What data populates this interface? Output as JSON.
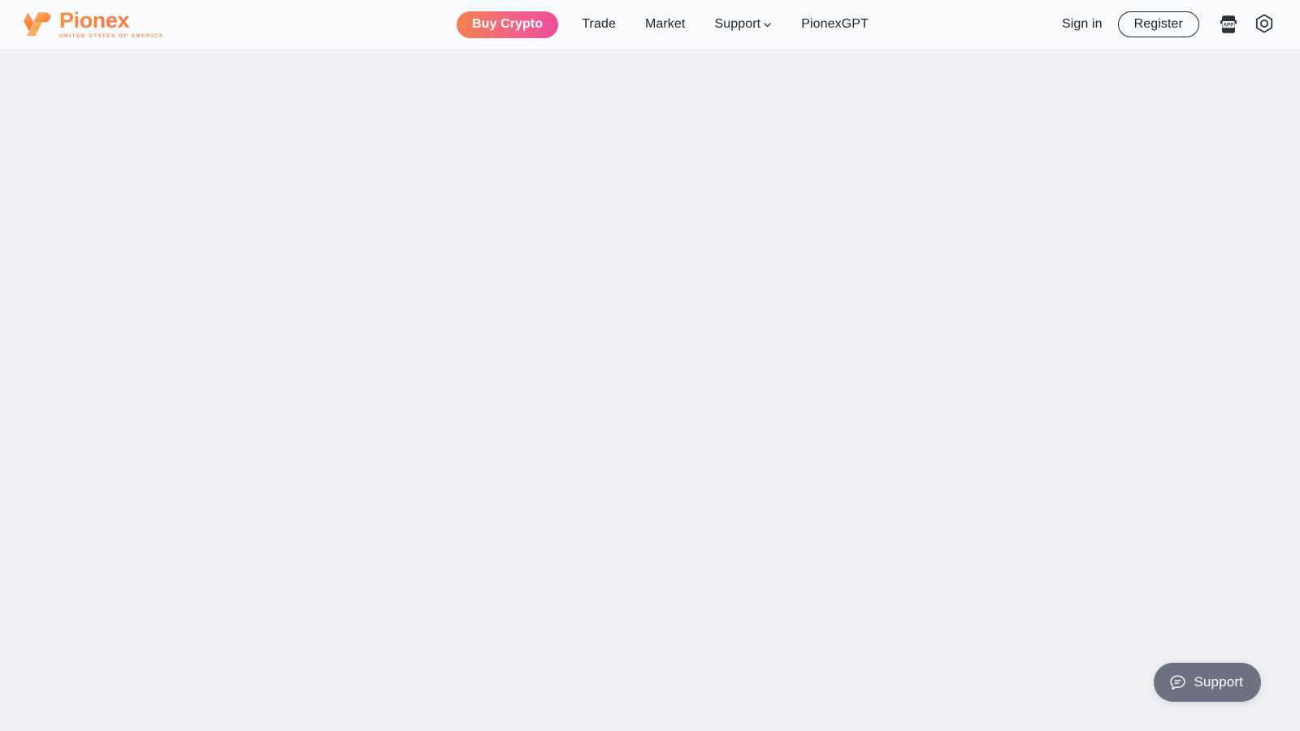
{
  "header": {
    "logo": {
      "name": "Pionex",
      "subtitle": "UNITED STATES OF AMERICA",
      "mark_icon": "pionex-p-mark-icon",
      "gradient_start": "#FA8B3C",
      "gradient_end": "#F9763F",
      "subtitle_color": "#FB8E55"
    },
    "background_color": "#FAFBFD",
    "primary_cta": {
      "label": "Buy Crypto",
      "gradient_start": "#F6824F",
      "gradient_end": "#EE4E9B",
      "text_color": "#FFFFFF"
    },
    "nav_items": [
      {
        "label": "Trade",
        "has_dropdown": false
      },
      {
        "label": "Market",
        "has_dropdown": false
      },
      {
        "label": "Support",
        "has_dropdown": true,
        "caret_icon": "chevron-down-icon"
      },
      {
        "label": "PionexGPT",
        "has_dropdown": false
      }
    ],
    "account": {
      "sign_in_label": "Sign in",
      "register_label": "Register"
    },
    "icons": [
      {
        "name": "app-download-icon",
        "text": "APP",
        "title": "APP"
      },
      {
        "name": "settings-hexagon-icon",
        "title": "Settings"
      }
    ],
    "text_color": "#1E2329"
  },
  "main": {
    "background_color": "#F0F1F4",
    "content": ""
  },
  "support_widget": {
    "label": "Support",
    "icon": "chat-bubble-icon",
    "background_color": "#6B7280",
    "text_color": "#FFFFFF"
  }
}
